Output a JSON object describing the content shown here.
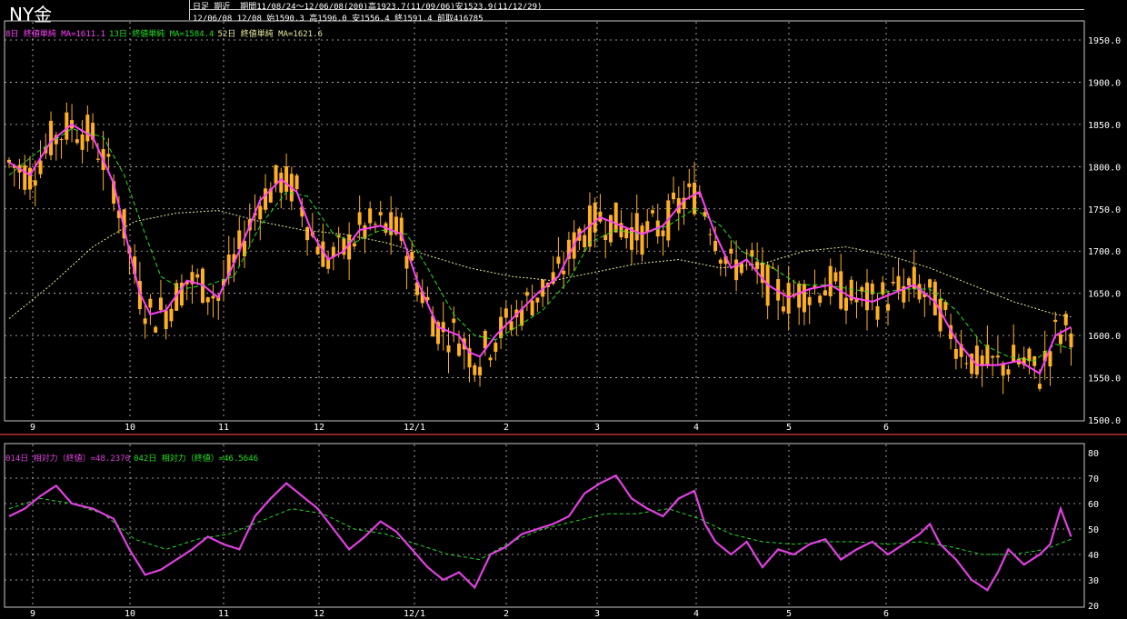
{
  "title": "NY金",
  "header": {
    "line1": "日足 期近  期間11/08/24～12/06/08(200)高1923.7(11/09/06)安1523.9(11/12/29)",
    "line2": "12/06/08 12/08 始1590.3 高1596.0 安1556.4 終1591.4 前取416785"
  },
  "colors": {
    "background": "#000000",
    "candle": "#ffb020",
    "ma_short": "#ff40ff",
    "ma_mid": "#20e020",
    "ma_long": "#e8e8a0",
    "grid": "#c8c8c8",
    "rsi_short": "#e040e0",
    "rsi_long": "#20e020",
    "divider": "#c03030"
  },
  "legend_top": [
    {
      "text": "8日 終値単純 MA=1611.1",
      "color": "#ff40ff"
    },
    {
      "text": "13日 終値単純 MA=1584.4",
      "color": "#20e020"
    },
    {
      "text": "52日 終値単純 MA=1621.6",
      "color": "#e8e8a0"
    }
  ],
  "legend_bottom": [
    {
      "text": "014日 相対力（終値）=48.2370",
      "color": "#e040e0"
    },
    {
      "text": "042日 相対力（終値）=46.5646",
      "color": "#20e020"
    }
  ],
  "chart_data": [
    {
      "type": "candlestick",
      "x_labels": [
        "9",
        "10",
        "11",
        "12",
        "12/1",
        "2",
        "3",
        "4",
        "5",
        "6"
      ],
      "y_ticks": [
        1950.0,
        1900.0,
        1850.0,
        1800.0,
        1750.0,
        1700.0,
        1650.0,
        1600.0,
        1550.0,
        1500.0
      ],
      "ylim": [
        1500,
        1960
      ],
      "series": [
        {
          "name": "8日 終値単純",
          "type": "line",
          "anchors": [
            [
              0,
              1805
            ],
            [
              4,
              1790
            ],
            [
              8,
              1830
            ],
            [
              12,
              1850
            ],
            [
              16,
              1835
            ],
            [
              20,
              1780
            ],
            [
              23,
              1700
            ],
            [
              25,
              1650
            ],
            [
              27,
              1625
            ],
            [
              30,
              1630
            ],
            [
              34,
              1665
            ],
            [
              37,
              1660
            ],
            [
              40,
              1645
            ],
            [
              44,
              1700
            ],
            [
              48,
              1760
            ],
            [
              52,
              1785
            ],
            [
              55,
              1770
            ],
            [
              58,
              1720
            ],
            [
              61,
              1690
            ],
            [
              64,
              1700
            ],
            [
              67,
              1725
            ],
            [
              71,
              1730
            ],
            [
              75,
              1720
            ],
            [
              78,
              1665
            ],
            [
              82,
              1610
            ],
            [
              86,
              1600
            ],
            [
              88,
              1580
            ],
            [
              90,
              1575
            ],
            [
              93,
              1600
            ],
            [
              97,
              1625
            ],
            [
              101,
              1650
            ],
            [
              105,
              1670
            ],
            [
              109,
              1720
            ],
            [
              113,
              1740
            ],
            [
              117,
              1730
            ],
            [
              121,
              1720
            ],
            [
              125,
              1730
            ],
            [
              129,
              1760
            ],
            [
              132,
              1770
            ],
            [
              135,
              1720
            ],
            [
              138,
              1680
            ],
            [
              141,
              1690
            ],
            [
              145,
              1660
            ],
            [
              149,
              1645
            ],
            [
              153,
              1655
            ],
            [
              157,
              1660
            ],
            [
              161,
              1645
            ],
            [
              165,
              1640
            ],
            [
              169,
              1650
            ],
            [
              173,
              1660
            ],
            [
              177,
              1640
            ],
            [
              181,
              1595
            ],
            [
              185,
              1565
            ],
            [
              189,
              1565
            ],
            [
              193,
              1570
            ],
            [
              197,
              1555
            ],
            [
              200,
              1600
            ],
            [
              203,
              1610
            ]
          ]
        },
        {
          "name": "13日 終値単純",
          "type": "line",
          "anchors": [
            [
              0,
              1790
            ],
            [
              6,
              1820
            ],
            [
              12,
              1845
            ],
            [
              18,
              1835
            ],
            [
              22,
              1790
            ],
            [
              26,
              1720
            ],
            [
              29,
              1670
            ],
            [
              33,
              1655
            ],
            [
              38,
              1660
            ],
            [
              43,
              1670
            ],
            [
              48,
              1730
            ],
            [
              53,
              1770
            ],
            [
              57,
              1765
            ],
            [
              62,
              1720
            ],
            [
              66,
              1710
            ],
            [
              71,
              1725
            ],
            [
              76,
              1720
            ],
            [
              80,
              1680
            ],
            [
              85,
              1625
            ],
            [
              89,
              1600
            ],
            [
              93,
              1595
            ],
            [
              97,
              1610
            ],
            [
              102,
              1630
            ],
            [
              107,
              1665
            ],
            [
              111,
              1710
            ],
            [
              116,
              1725
            ],
            [
              121,
              1720
            ],
            [
              126,
              1730
            ],
            [
              131,
              1750
            ],
            [
              136,
              1730
            ],
            [
              140,
              1700
            ],
            [
              146,
              1680
            ],
            [
              151,
              1660
            ],
            [
              156,
              1660
            ],
            [
              161,
              1655
            ],
            [
              166,
              1650
            ],
            [
              171,
              1655
            ],
            [
              176,
              1655
            ],
            [
              181,
              1630
            ],
            [
              186,
              1590
            ],
            [
              191,
              1575
            ],
            [
              196,
              1570
            ],
            [
              200,
              1590
            ],
            [
              203,
              1584
            ]
          ]
        },
        {
          "name": "52日 終値単純",
          "type": "line",
          "anchors": [
            [
              0,
              1620
            ],
            [
              8,
              1660
            ],
            [
              16,
              1705
            ],
            [
              24,
              1735
            ],
            [
              32,
              1745
            ],
            [
              40,
              1748
            ],
            [
              48,
              1735
            ],
            [
              56,
              1725
            ],
            [
              64,
              1720
            ],
            [
              72,
              1710
            ],
            [
              80,
              1695
            ],
            [
              88,
              1680
            ],
            [
              96,
              1670
            ],
            [
              104,
              1665
            ],
            [
              112,
              1675
            ],
            [
              120,
              1685
            ],
            [
              128,
              1690
            ],
            [
              136,
              1680
            ],
            [
              144,
              1685
            ],
            [
              152,
              1700
            ],
            [
              160,
              1705
            ],
            [
              168,
              1695
            ],
            [
              176,
              1680
            ],
            [
              184,
              1660
            ],
            [
              192,
              1640
            ],
            [
              200,
              1625
            ],
            [
              203,
              1622
            ]
          ]
        }
      ]
    },
    {
      "type": "line",
      "x_labels": [
        "9",
        "10",
        "11",
        "12",
        "12/1",
        "2",
        "3",
        "4",
        "5",
        "6"
      ],
      "y_ticks": [
        80,
        70,
        60,
        50,
        40,
        30,
        20
      ],
      "ylim": [
        20,
        80
      ],
      "series": [
        {
          "name": "014日 相対力（終値）",
          "anchors": [
            [
              0,
              55
            ],
            [
              3,
              58
            ],
            [
              6,
              63
            ],
            [
              9,
              67
            ],
            [
              12,
              60
            ],
            [
              16,
              58
            ],
            [
              20,
              54
            ],
            [
              23,
              42
            ],
            [
              26,
              32
            ],
            [
              29,
              34
            ],
            [
              32,
              38
            ],
            [
              35,
              42
            ],
            [
              38,
              47
            ],
            [
              41,
              44
            ],
            [
              44,
              42
            ],
            [
              47,
              55
            ],
            [
              50,
              62
            ],
            [
              53,
              68
            ],
            [
              56,
              63
            ],
            [
              59,
              58
            ],
            [
              62,
              50
            ],
            [
              65,
              42
            ],
            [
              68,
              47
            ],
            [
              71,
              53
            ],
            [
              74,
              49
            ],
            [
              77,
              42
            ],
            [
              80,
              35
            ],
            [
              83,
              30
            ],
            [
              86,
              33
            ],
            [
              89,
              27
            ],
            [
              92,
              40
            ],
            [
              95,
              43
            ],
            [
              98,
              48
            ],
            [
              101,
              50
            ],
            [
              104,
              52
            ],
            [
              107,
              55
            ],
            [
              110,
              64
            ],
            [
              113,
              68
            ],
            [
              116,
              71
            ],
            [
              119,
              62
            ],
            [
              122,
              58
            ],
            [
              125,
              55
            ],
            [
              128,
              62
            ],
            [
              131,
              65
            ],
            [
              133,
              52
            ],
            [
              135,
              45
            ],
            [
              138,
              40
            ],
            [
              141,
              45
            ],
            [
              144,
              35
            ],
            [
              147,
              42
            ],
            [
              150,
              40
            ],
            [
              153,
              44
            ],
            [
              156,
              46
            ],
            [
              159,
              38
            ],
            [
              162,
              42
            ],
            [
              165,
              45
            ],
            [
              168,
              40
            ],
            [
              171,
              44
            ],
            [
              174,
              48
            ],
            [
              176,
              52
            ],
            [
              178,
              44
            ],
            [
              181,
              38
            ],
            [
              184,
              30
            ],
            [
              187,
              26
            ],
            [
              189,
              33
            ],
            [
              191,
              42
            ],
            [
              194,
              36
            ],
            [
              197,
              40
            ],
            [
              199,
              44
            ],
            [
              201,
              58
            ],
            [
              203,
              47
            ]
          ]
        },
        {
          "name": "042日 相対力（終値）",
          "anchors": [
            [
              0,
              58
            ],
            [
              6,
              62
            ],
            [
              12,
              60
            ],
            [
              18,
              56
            ],
            [
              24,
              46
            ],
            [
              30,
              42
            ],
            [
              36,
              46
            ],
            [
              42,
              48
            ],
            [
              48,
              53
            ],
            [
              54,
              58
            ],
            [
              60,
              56
            ],
            [
              66,
              50
            ],
            [
              72,
              48
            ],
            [
              78,
              44
            ],
            [
              84,
              40
            ],
            [
              90,
              38
            ],
            [
              96,
              45
            ],
            [
              102,
              50
            ],
            [
              108,
              53
            ],
            [
              114,
              56
            ],
            [
              120,
              56
            ],
            [
              126,
              58
            ],
            [
              132,
              54
            ],
            [
              138,
              48
            ],
            [
              144,
              45
            ],
            [
              150,
              44
            ],
            [
              156,
              45
            ],
            [
              162,
              45
            ],
            [
              168,
              44
            ],
            [
              174,
              45
            ],
            [
              180,
              43
            ],
            [
              186,
              40
            ],
            [
              192,
              40
            ],
            [
              198,
              42
            ],
            [
              203,
              46
            ]
          ]
        }
      ]
    }
  ]
}
